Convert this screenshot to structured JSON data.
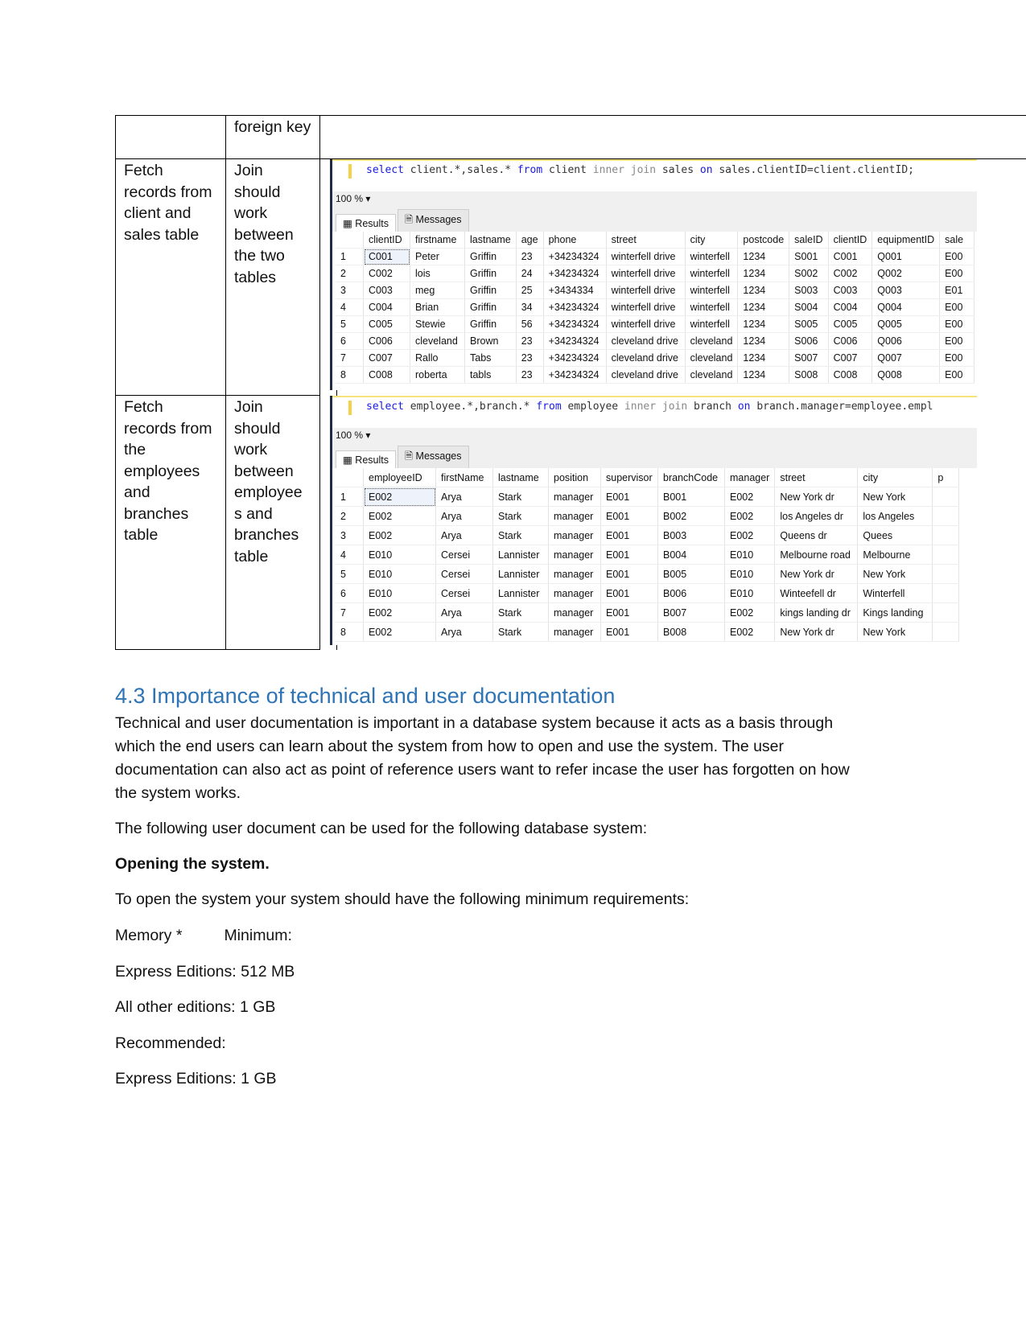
{
  "table_rows": [
    {
      "c1": "",
      "c2": "foreign key"
    },
    {
      "c1": "Fetch records from client and sales table",
      "c2": "Join should work between the two tables"
    },
    {
      "c1": "Fetch records from the employees and branches table",
      "c2": "Join should work between employee s and branches table"
    }
  ],
  "shot1": {
    "sql": [
      [
        "kw",
        "select"
      ],
      [
        "",
        "client.*,sales.*"
      ],
      [
        "kw",
        "from"
      ],
      [
        "",
        "client"
      ],
      [
        "gr",
        "inner join"
      ],
      [
        "",
        "sales"
      ],
      [
        "kw",
        "on"
      ],
      [
        "",
        "sales.clientID=client.clientID;"
      ]
    ],
    "zoom": "100 %",
    "tabs": [
      "Results",
      "Messages"
    ],
    "headers": [
      "",
      "clientID",
      "firstname",
      "lastname",
      "age",
      "phone",
      "street",
      "city",
      "postcode",
      "saleID",
      "clientID",
      "equipmentID",
      "sale"
    ],
    "rows": [
      [
        "1",
        "C001",
        "Peter",
        "Griffin",
        "23",
        "+34234324",
        "winterfell drive",
        "winterfell",
        "1234",
        "S001",
        "C001",
        "Q001",
        "E00"
      ],
      [
        "2",
        "C002",
        "lois",
        "Griffin",
        "24",
        "+34234324",
        "winterfell drive",
        "winterfell",
        "1234",
        "S002",
        "C002",
        "Q002",
        "E00"
      ],
      [
        "3",
        "C003",
        "meg",
        "Griffin",
        "25",
        "+3434334",
        "winterfell drive",
        "winterfell",
        "1234",
        "S003",
        "C003",
        "Q003",
        "E01"
      ],
      [
        "4",
        "C004",
        "Brian",
        "Griffin",
        "34",
        "+34234324",
        "winterfell drive",
        "winterfell",
        "1234",
        "S004",
        "C004",
        "Q004",
        "E00"
      ],
      [
        "5",
        "C005",
        "Stewie",
        "Griffin",
        "56",
        "+34234324",
        "winterfell drive",
        "winterfell",
        "1234",
        "S005",
        "C005",
        "Q005",
        "E00"
      ],
      [
        "6",
        "C006",
        "cleveland",
        "Brown",
        "23",
        "+34234324",
        "cleveland drive",
        "cleveland",
        "1234",
        "S006",
        "C006",
        "Q006",
        "E00"
      ],
      [
        "7",
        "C007",
        "Rallo",
        "Tabs",
        "23",
        "+34234324",
        "cleveland drive",
        "cleveland",
        "1234",
        "S007",
        "C007",
        "Q007",
        "E00"
      ],
      [
        "8",
        "C008",
        "roberta",
        "tabls",
        "23",
        "+34234324",
        "cleveland drive",
        "cleveland",
        "1234",
        "S008",
        "C008",
        "Q008",
        "E00"
      ]
    ]
  },
  "shot2": {
    "sql": [
      [
        "kw",
        "select"
      ],
      [
        "",
        "employee.*,branch.*"
      ],
      [
        "kw",
        "from"
      ],
      [
        "",
        "employee"
      ],
      [
        "gr",
        "inner join"
      ],
      [
        "",
        "branch"
      ],
      [
        "kw",
        "on"
      ],
      [
        "",
        "branch.manager=employee.empl"
      ]
    ],
    "zoom": "100 %",
    "tabs": [
      "Results",
      "Messages"
    ],
    "headers": [
      "",
      "employeeID",
      "firstName",
      "lastname",
      "position",
      "supervisor",
      "branchCode",
      "manager",
      "street",
      "city",
      "p"
    ],
    "rows": [
      [
        "1",
        "E002",
        "Arya",
        "Stark",
        "manager",
        "E001",
        "B001",
        "E002",
        "New York dr",
        "New York",
        ""
      ],
      [
        "2",
        "E002",
        "Arya",
        "Stark",
        "manager",
        "E001",
        "B002",
        "E002",
        "los Angeles dr",
        "los Angeles",
        ""
      ],
      [
        "3",
        "E002",
        "Arya",
        "Stark",
        "manager",
        "E001",
        "B003",
        "E002",
        "Queens dr",
        "Quees",
        ""
      ],
      [
        "4",
        "E010",
        "Cersei",
        "Lannister",
        "manager",
        "E001",
        "B004",
        "E010",
        "Melbourne road",
        "Melbourne",
        ""
      ],
      [
        "5",
        "E010",
        "Cersei",
        "Lannister",
        "manager",
        "E001",
        "B005",
        "E010",
        "New York dr",
        "New York",
        ""
      ],
      [
        "6",
        "E010",
        "Cersei",
        "Lannister",
        "manager",
        "E001",
        "B006",
        "E010",
        "Winteefell dr",
        "Winterfell",
        ""
      ],
      [
        "7",
        "E002",
        "Arya",
        "Stark",
        "manager",
        "E001",
        "B007",
        "E002",
        "kings landing dr",
        "Kings landing",
        ""
      ],
      [
        "8",
        "E002",
        "Arya",
        "Stark",
        "manager",
        "E001",
        "B008",
        "E002",
        "New York dr",
        "New York",
        ""
      ]
    ]
  },
  "section": {
    "heading": "4.3 Importance of technical and user documentation",
    "para1": "Technical and user documentation is important in a database system because it acts as a basis through which the end users can learn about the system from how to open and use the system. The user documentation can also act as point of reference users want to refer incase the user has forgotten on how the system works.",
    "para2": "The following user document can be used for the following database system:",
    "bold": "Opening the system.",
    "para3": "To open the system your system should have the following minimum requirements:",
    "memory": "Memory *",
    "minimum": "Minimum:",
    "l1": "Express Editions: 512 MB",
    "l2": "All other editions: 1 GB",
    "l3": "Recommended:",
    "l4": "Express Editions: 1 GB"
  }
}
